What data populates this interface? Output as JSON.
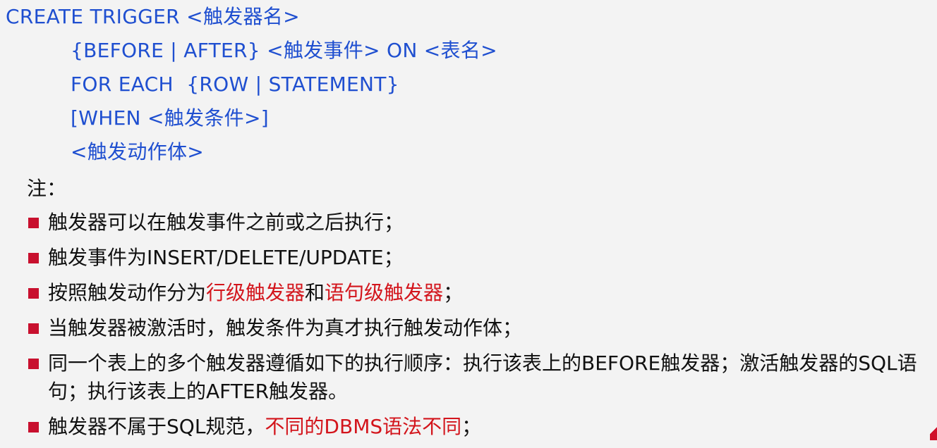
{
  "code": {
    "lines": [
      "CREATE TRIGGER <触发器名>",
      "{BEFORE | AFTER} <触发事件> ON <表名>",
      "FOR EACH  {ROW | STATEMENT}",
      "[WHEN <触发条件>]",
      "<触发动作体>"
    ]
  },
  "notes": {
    "label": "注：",
    "bullets": [
      {
        "text": "触发器可以在触发事件之前或之后执行；"
      },
      {
        "text": "触发事件为INSERT/DELETE/UPDATE；"
      },
      {
        "pre": "按照触发动作分为",
        "red1": "行级触发器",
        "mid": "和",
        "red2": "语句级触发器",
        "post": "；"
      },
      {
        "text": "当触发器被激活时，触发条件为真才执行触发动作体；"
      },
      {
        "text": "同一个表上的多个触发器遵循如下的执行顺序：执行该表上的BEFORE触发器；激活触发器的SQL语句；执行该表上的AFTER触发器。"
      },
      {
        "pre": "触发器不属于SQL规范，",
        "red1": "不同的DBMS语法不同",
        "post": "；"
      }
    ]
  },
  "colors": {
    "code": "#1f4fd0",
    "highlight": "#d3151c",
    "bullet": "#c8102e",
    "background": "#f3f3f3"
  }
}
